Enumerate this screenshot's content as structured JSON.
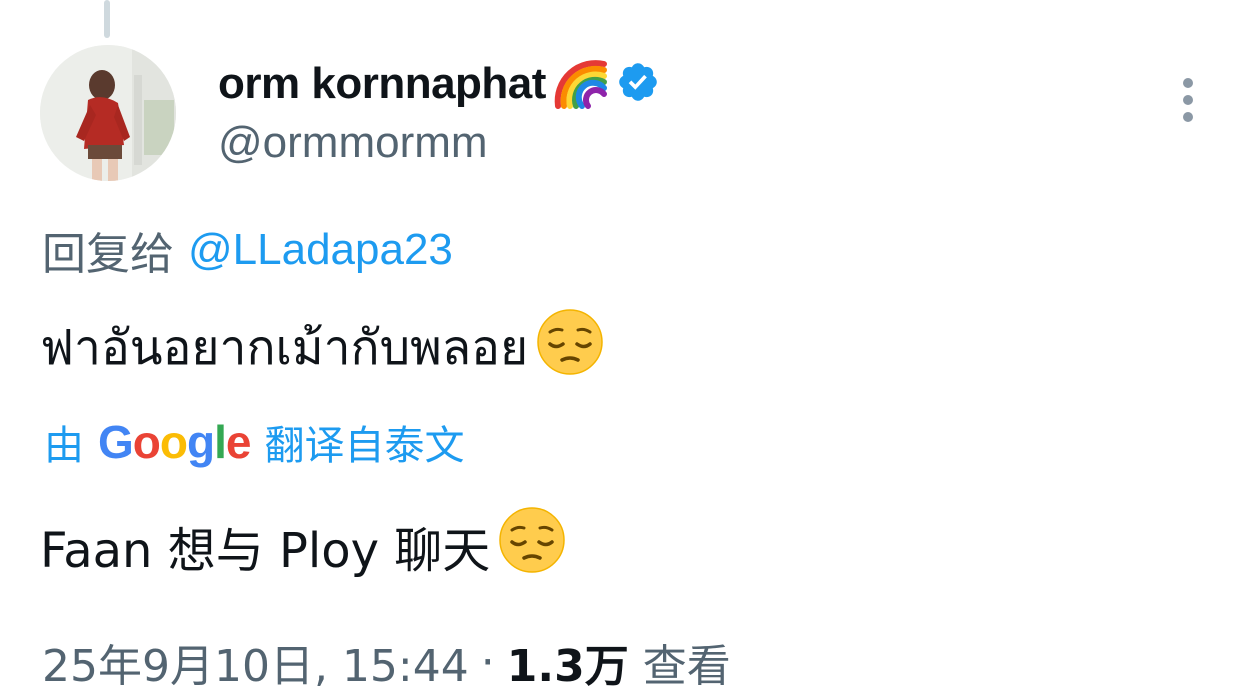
{
  "tweet": {
    "author": {
      "display_name": "orm kornnaphat",
      "handle": "@ormmormm",
      "verified": true
    },
    "reply_prefix": "回复给",
    "reply_to": "@LLadapa23",
    "text": "ฟาอันอยากเม้ากับพลอย",
    "translation": {
      "prefix": "由",
      "provider": "Google",
      "suffix": "翻译自泰文",
      "text": "Faan 想与 Ploy 聊天"
    },
    "timestamp": "25年9月10日, 15:44",
    "separator": "·",
    "views_count": "1.3万",
    "views_label": "查看"
  },
  "icons": {
    "rainbow": "rainbow-emoji",
    "verified": "verified-badge-icon",
    "more": "more-vertical-icon",
    "pensive": "pensive-face-emoji"
  },
  "colors": {
    "link": "#1d9bf0",
    "secondary_text": "#536471",
    "primary_text": "#0f1419",
    "google_blue": "#4285f4",
    "google_red": "#ea4335",
    "google_yellow": "#fbbc05",
    "google_green": "#34a853"
  }
}
